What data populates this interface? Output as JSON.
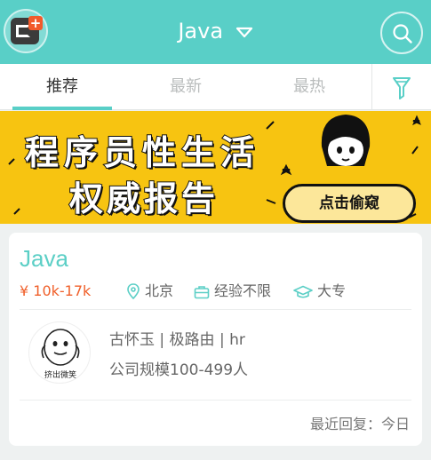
{
  "header": {
    "title": "Java",
    "logo_icon": "app-logo-icon",
    "search_icon": "search-icon",
    "background": "#59cfc7"
  },
  "tabs": [
    {
      "label": "推荐",
      "active": true
    },
    {
      "label": "最新",
      "active": false
    },
    {
      "label": "最热",
      "active": false
    }
  ],
  "filter_icon": "filter-icon",
  "banner": {
    "line1": "程序员性生活",
    "line2": "权威报告",
    "cta": "点击偷窥"
  },
  "job": {
    "title": "Java",
    "salary": "¥ 10k-17k",
    "location": "北京",
    "experience": "经验不限",
    "education": "大专",
    "avatar_caption": "挤出微笑",
    "recruiter": "古怀玉 | 极路由 | hr",
    "company_size": "公司规模100-499人",
    "last_reply": "最近回复：今日",
    "accent_color": "#5ccfc6",
    "salary_color": "#f0602b"
  }
}
